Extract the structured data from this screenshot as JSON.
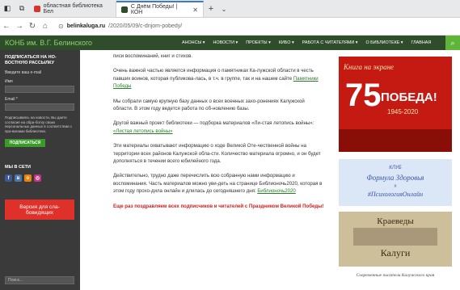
{
  "browser": {
    "tabs": [
      {
        "label": "областная библиотека Бел"
      },
      {
        "label": "С Днём Победы! | КОН"
      }
    ],
    "url_domain": "belinkaluga.ru",
    "url_path": "/2020/05/09/c-dnjom-pobedy/"
  },
  "site": {
    "logo": "КОНБ им. В.Г. Белинского",
    "menu": [
      "АНОНСЫ ▾",
      "НОВОСТИ ▾",
      "ПРОЕКТЫ ▾",
      "КИБО ▾",
      "РАБОТА С ЧИТАТЕЛЯМИ ▾",
      "О БИБЛИОТЕКЕ ▾",
      "ГЛАВНАЯ"
    ]
  },
  "sidebar": {
    "subscribe_heading": "ПОДПИСАТЬСЯ НА НО-ВОСТНУЮ РАССЫЛКУ",
    "email_placeholder": "Введите ваш e-mail",
    "name_label": "Имя",
    "email_label": "Email *",
    "consent_text": "Подписываясь на новости, Вы даете согласие на обра-ботку своих персональных данных в соответствии с пра-вилами библиотеки.",
    "subscribe_button": "ПОДПИСАТЬСЯ",
    "social_heading": "МЫ В СЕТИ",
    "blind_button": "Версия для сла-бовидящих",
    "search_placeholder": "Поиск..."
  },
  "main": {
    "paragraphs": [
      {
        "text": "писи воспоминаний, книг и стихов."
      },
      {
        "text": "Очень важной частью является информация о памятниках Ка-лужской области в честь павших воинов, которая публикова-лась, в т.ч. в группе, так и на нашем сайте ",
        "link": "Памятники Победы"
      },
      {
        "text": "Мы собрали самую крупную базу данных о всех военных захо-ронениях Калужской области. В этом году ведется работа по об-новлению базы."
      },
      {
        "text": "Другой важный проект библиотеки — подборка материалов «Ли-стая летопись войны»: ",
        "link": "«Листая летопись войны»"
      },
      {
        "text": "Эти материалы охватывают информацию о ходе Великой Оте-чественной войны на территории всех районов Калужской обла-сти. Количество материала огромно, и он будет дополняться в течении всего юбилейного года."
      },
      {
        "text": "Действительно, трудно даже перечислить всю собранную нами информацию и воспоминания. Часть материалов можно уви-деть на странице Библионочь2020, которая в этом году прохо-дила онлайн и длилась до сегодняшнего дня: ",
        "link": "Библионочь2020"
      }
    ],
    "closing": "Еще раз поздравляем всех подписчиков и читателей с Праздником Великой Победы!"
  },
  "banners": {
    "b1_top": "Книга на экране",
    "b1_number": "75",
    "b1_title": "ПОБЕДА!",
    "b1_years": "1945-2020",
    "b2_l1": "КЛУБ",
    "b2_l2": "Формула Здоровья",
    "b2_l3": "#",
    "b2_l4": "#ПсихологияОнлайн",
    "b3_l1": "Краеведы",
    "b3_l2": "Калуги",
    "b4": "Современные писатели Калужского края"
  },
  "colors": {
    "header_bg": "#2f4d2b",
    "sidebar_bg": "#3a3a3a",
    "accent_green": "#3b9a2a",
    "link": "#2a7d2a",
    "red": "#d41c1c"
  }
}
